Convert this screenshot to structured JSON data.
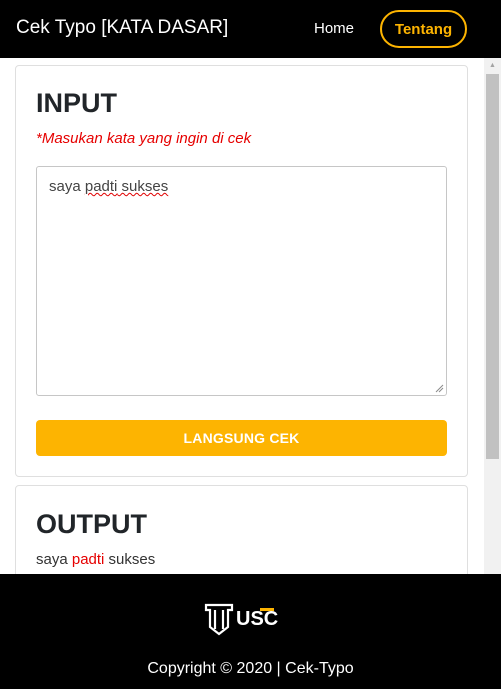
{
  "navbar": {
    "brand": "Cek Typo [KATA DASAR]",
    "links": {
      "home": "Home",
      "tentang": "Tentang"
    }
  },
  "input_card": {
    "title": "INPUT",
    "hint": "*Masukan kata yang ingin di cek",
    "textarea": {
      "before": "saya ",
      "typo": "padti",
      "after": " sukses"
    },
    "button": "LANGSUNG CEK"
  },
  "output_card": {
    "title": "OUTPUT",
    "result": {
      "before": "saya ",
      "typo": "padti",
      "after": " sukses"
    }
  },
  "footer": {
    "logo_text": "USC",
    "copyright": "Copyright © 2020 | Cek-Typo"
  },
  "colors": {
    "accent": "#fdb401",
    "typo": "#e60000",
    "navbar_bg": "#000000"
  },
  "icons": {
    "logo": "usc-logo-icon",
    "resize": "resize-grip-icon",
    "scroll_up": "scroll-up-arrow-icon"
  }
}
